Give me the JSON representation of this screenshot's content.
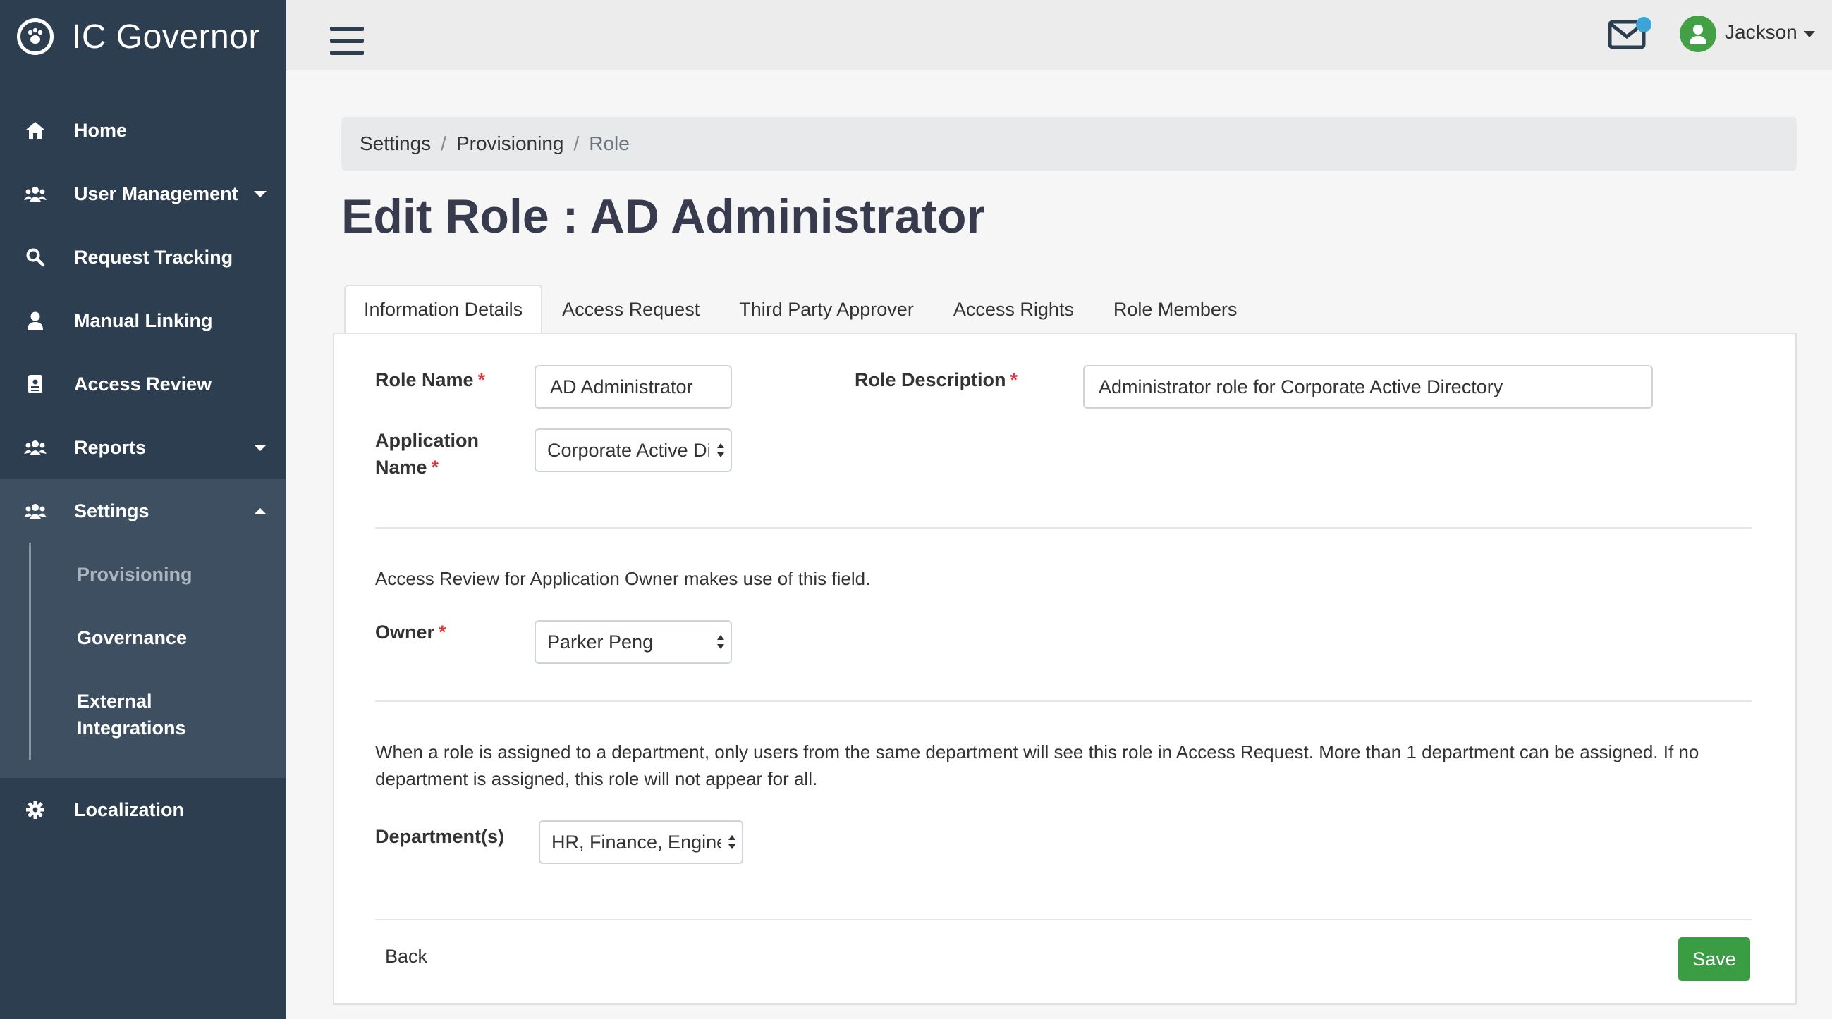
{
  "app": {
    "brand": "IC Governor"
  },
  "sidebar": {
    "items": [
      {
        "label": "Home",
        "icon": "home-icon"
      },
      {
        "label": "User Management",
        "icon": "users-icon"
      },
      {
        "label": "Request Tracking",
        "icon": "search-icon"
      },
      {
        "label": "Manual Linking",
        "icon": "user-icon"
      },
      {
        "label": "Access Review",
        "icon": "id-card-icon"
      },
      {
        "label": "Reports",
        "icon": "users-icon"
      },
      {
        "label": "Settings",
        "icon": "users-icon"
      },
      {
        "label": "Localization",
        "icon": "gear-icon"
      }
    ],
    "settings_sub": [
      {
        "label": "Provisioning"
      },
      {
        "label": "Governance"
      },
      {
        "label": "External Integrations"
      }
    ]
  },
  "topbar": {
    "user_name": "Jackson"
  },
  "breadcrumb": {
    "items": [
      "Settings",
      "Provisioning",
      "Role"
    ],
    "separator": "/"
  },
  "page": {
    "title": "Edit Role : AD Administrator"
  },
  "tabs": [
    "Information Details",
    "Access Request",
    "Third Party Approver",
    "Access Rights",
    "Role Members"
  ],
  "form": {
    "role_name_label": "Role Name",
    "role_name_value": "AD Administrator",
    "role_desc_label": "Role Description",
    "role_desc_value": "Administrator role for Corporate Active Directory",
    "app_name_label_1": "Application",
    "app_name_label_2": "Name",
    "app_name_value": "Corporate Active Directory",
    "required_mark": "*",
    "owner_note": "Access Review for Application Owner makes use of this field.",
    "owner_label": "Owner",
    "owner_value": "Parker Peng",
    "dept_note_1": "When a role is assigned to a department, only users from the same department will see this role in Access Request. More than 1 department can be assigned. If no",
    "dept_note_2": "department is assigned, this role will not appear for all.",
    "dept_label": "Department(s)",
    "dept_value": "HR, Finance, Engineering",
    "back_label": "Back",
    "save_label": "Save"
  },
  "colors": {
    "sidebar": "#2c3e50",
    "sidebar_active": "#3d4f61",
    "accent_green": "#3a9d44",
    "notification": "#3aa5d6",
    "required": "#d9363e"
  }
}
